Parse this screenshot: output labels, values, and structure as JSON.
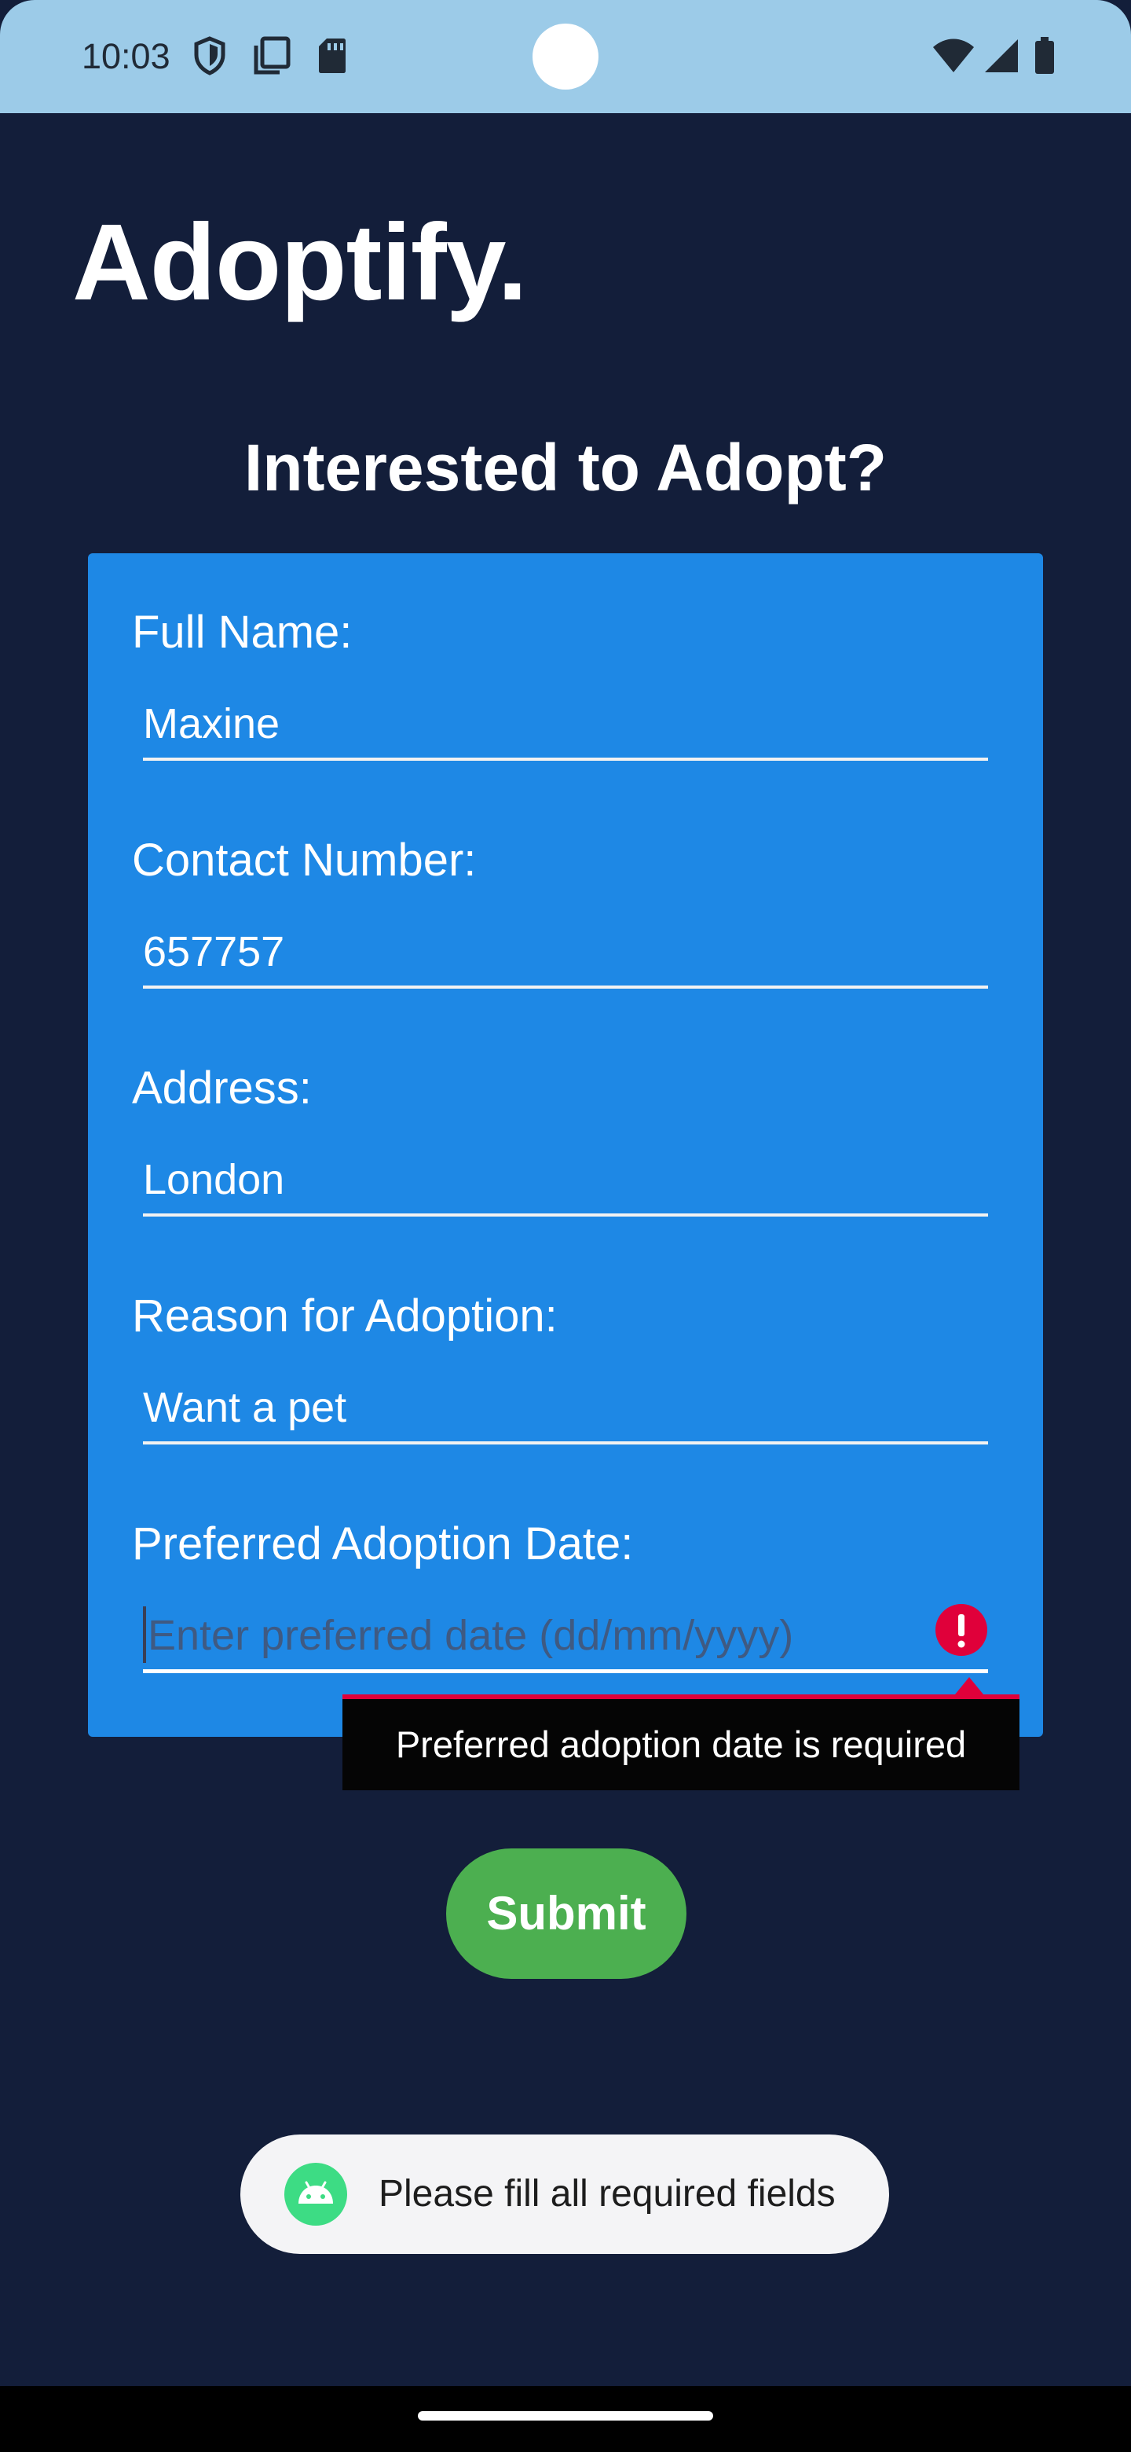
{
  "status_bar": {
    "time": "10:03",
    "left_icons": [
      "shield-icon",
      "screen-copy-icon",
      "sd-card-icon"
    ],
    "right_icons": [
      "wifi-icon",
      "cell-signal-icon",
      "battery-icon"
    ],
    "background_color": "#9ccbe8"
  },
  "app": {
    "title": "Adoptify."
  },
  "form": {
    "heading": "Interested to Adopt?",
    "card_color": "#1e88e5",
    "fields": [
      {
        "label": "Full Name:",
        "value": "Maxine"
      },
      {
        "label": "Contact Number:",
        "value": "657757"
      },
      {
        "label": "Address:",
        "value": "London"
      },
      {
        "label": "Reason for Adoption:",
        "value": "Want a pet"
      },
      {
        "label": "Preferred Adoption Date:",
        "value": "",
        "placeholder": "Enter preferred date (dd/mm/yyyy)"
      }
    ],
    "error": {
      "icon": "error-icon",
      "message": "Preferred adoption date is required",
      "color": "#e0003a"
    },
    "submit_label": "Submit",
    "submit_color": "#4caf50"
  },
  "toast": {
    "icon": "android-icon",
    "message": "Please fill all required fields"
  },
  "colors": {
    "background": "#131e3a"
  }
}
